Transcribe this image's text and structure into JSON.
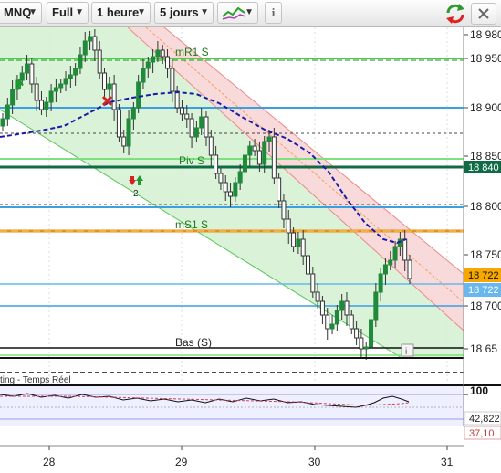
{
  "toolbar": {
    "symbol": "MNQ",
    "mode": "Full",
    "timeframe": "1 heure",
    "period": "5 jours",
    "info_glyph": "i",
    "icons": [
      "chart-type-icon",
      "info-icon",
      "refresh-icon",
      "close-icon"
    ]
  },
  "price_axis": {
    "ticks": [
      "18 980",
      "18 950",
      "18 900",
      "18 850",
      "18 800",
      "18 750",
      "18 700",
      "18 65"
    ],
    "badges": [
      {
        "text": "18 840",
        "color": "#0f6b45"
      },
      {
        "text": "18 722",
        "color": "#f6a800"
      },
      {
        "text": "18 722",
        "color": "#68b8ee"
      }
    ]
  },
  "levels": {
    "mR1": "mR1 S",
    "piv": "Piv S",
    "mS1": "mS1 S",
    "bas": "Bas (S)"
  },
  "annotations": {
    "signal_count": "2",
    "status_text": "ting - Temps Réel",
    "info_glyph": "i"
  },
  "oscillator": {
    "top_tick": "100",
    "values": [
      "42,822",
      "37,10"
    ]
  },
  "time_axis": {
    "labels": [
      "28",
      "29",
      "30",
      "31"
    ]
  },
  "colors": {
    "resistance_channel": "#f8d6d6",
    "support_channel": "#d4f0d0",
    "pivot_green": "#3dd63d",
    "orange_level": "#e8901a",
    "blue_level": "#3aa0e0",
    "ma_dashed": "#1a1aa8",
    "candle_up": "#1f8a3a",
    "candle_down": "#c42828"
  }
}
